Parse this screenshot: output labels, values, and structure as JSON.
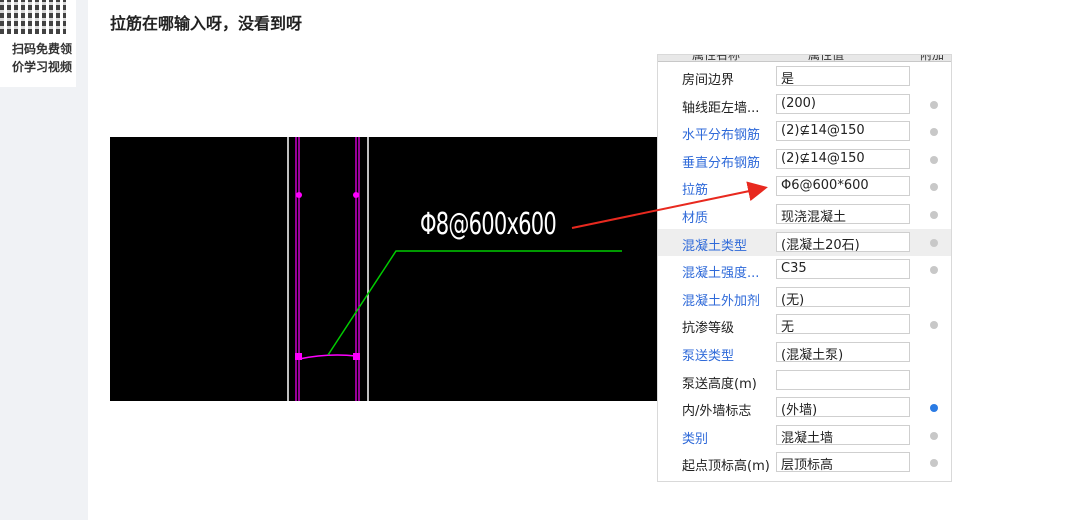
{
  "sidebar": {
    "qr_line1": "扫码免费领",
    "qr_line2": "价学习视频"
  },
  "question": {
    "title": "拉筋在哪输入呀，没看到呀"
  },
  "cad": {
    "annotation": "Φ8@600x600"
  },
  "panel": {
    "header_col1": "属性名称",
    "header_col2": "属性值",
    "header_col3": "附加",
    "rows": [
      {
        "name": "房间边界",
        "value": "是",
        "name_color": "black",
        "dot": "none"
      },
      {
        "name": "轴线距左墙...",
        "value": "(200)",
        "name_color": "black",
        "dot": "off"
      },
      {
        "name": "水平分布钢筋",
        "value": "(2)⊈14@150",
        "name_color": "blue",
        "dot": "off"
      },
      {
        "name": "垂直分布钢筋",
        "value": "(2)⊈14@150",
        "name_color": "blue",
        "dot": "off"
      },
      {
        "name": "拉筋",
        "value": "Φ6@600*600",
        "name_color": "blue",
        "dot": "off"
      },
      {
        "name": "材质",
        "value": "现浇混凝土",
        "name_color": "blue",
        "dot": "off"
      },
      {
        "name": "混凝土类型",
        "value": "(混凝土20石)",
        "name_color": "blue",
        "dot": "off"
      },
      {
        "name": "混凝土强度...",
        "value": "C35",
        "name_color": "blue",
        "dot": "off"
      },
      {
        "name": "混凝土外加剂",
        "value": "(无)",
        "name_color": "blue",
        "dot": "none"
      },
      {
        "name": "抗渗等级",
        "value": "无",
        "name_color": "black",
        "dot": "off"
      },
      {
        "name": "泵送类型",
        "value": "(混凝土泵)",
        "name_color": "blue",
        "dot": "none"
      },
      {
        "name": "泵送高度(m)",
        "value": "",
        "name_color": "black",
        "dot": "none"
      },
      {
        "name": "内/外墙标志",
        "value": "(外墙)",
        "name_color": "black",
        "dot": "on"
      },
      {
        "name": "类别",
        "value": "混凝土墙",
        "name_color": "blue",
        "dot": "off"
      },
      {
        "name": "起点顶标高(m)",
        "value": "层顶标高",
        "name_color": "black",
        "dot": "off"
      }
    ]
  },
  "colors": {
    "page_bg": "#f0f2f5",
    "cad_bg": "#000000",
    "wall_line": "#ff00ff",
    "leader_line": "#00cc00",
    "arrow": "#e8291f",
    "link_blue": "#2f6ad9",
    "dot_active": "#2a7be4"
  }
}
